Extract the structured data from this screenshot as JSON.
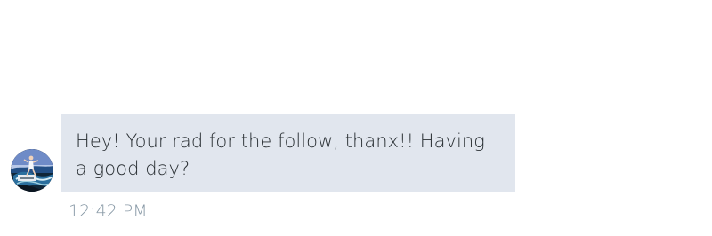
{
  "conversation": {
    "message": {
      "avatar_icon": "user-avatar-photo",
      "text": "Hey! Your rad for the follow, thanx!! Having a good day?",
      "time": "12:42 PM"
    }
  },
  "colors": {
    "bubble_background": "#e1e6ee",
    "message_text": "#292f33",
    "timestamp_text": "#8899a6"
  }
}
